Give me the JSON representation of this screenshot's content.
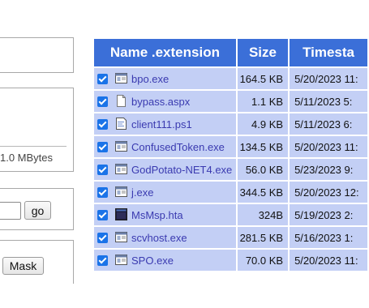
{
  "left": {
    "mbytes_text": "1.0 MBytes",
    "go_label": "go",
    "mask_label": "Mask"
  },
  "table": {
    "headers": [
      "Name .extension",
      "Size",
      "Timesta"
    ],
    "rows": [
      {
        "name": "bpo.exe",
        "size": "164.5 KB",
        "time": "5/20/2023 11:",
        "icon": "exe-icon",
        "checked": true
      },
      {
        "name": "bypass.aspx",
        "size": "1.1 KB",
        "time": "5/11/2023 5:",
        "icon": "blank-file-icon",
        "checked": true
      },
      {
        "name": "client111.ps1",
        "size": "4.9 KB",
        "time": "5/11/2023 6:",
        "icon": "script-file-icon",
        "checked": true
      },
      {
        "name": "ConfusedToken.exe",
        "size": "134.5 KB",
        "time": "5/20/2023 11:",
        "icon": "exe-icon",
        "checked": true
      },
      {
        "name": "GodPotato-NET4.exe",
        "size": "56.0 KB",
        "time": "5/23/2023 9:",
        "icon": "exe-icon",
        "checked": true
      },
      {
        "name": "j.exe",
        "size": "344.5 KB",
        "time": "5/20/2023 12:",
        "icon": "exe-icon",
        "checked": true
      },
      {
        "name": "MsMsp.hta",
        "size": "324B",
        "time": "5/19/2023 2:",
        "icon": "hta-app-icon",
        "checked": true
      },
      {
        "name": "scvhost.exe",
        "size": "281.5 KB",
        "time": "5/16/2023 1:",
        "icon": "exe-icon",
        "checked": true
      },
      {
        "name": "SPO.exe",
        "size": "70.0 KB",
        "time": "5/20/2023 11:",
        "icon": "exe-icon",
        "checked": true
      }
    ]
  },
  "colors": {
    "header_bg": "#3b6fd8",
    "row_bg": "#c3cff5",
    "checkbox": "#1a73e8",
    "link": "#3a3ab0"
  }
}
